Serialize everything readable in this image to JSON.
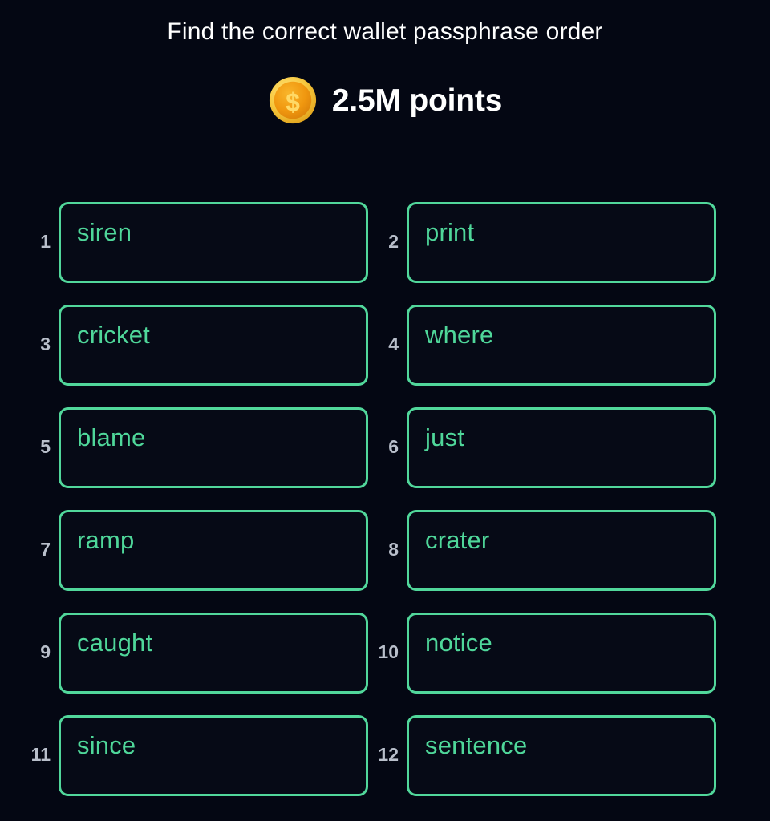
{
  "header": {
    "title": "Find the correct wallet passphrase order",
    "points_label": "2.5M points",
    "coin_icon": "coin-dollar-icon"
  },
  "colors": {
    "background": "#040713",
    "tile_background": "#060a16",
    "tile_border": "#51d79b",
    "word_text": "#4fd79a",
    "index_text": "#b9bfcb",
    "title_text": "#ffffff",
    "coin_outer": "#f5c542",
    "coin_inner": "#f0970f",
    "coin_symbol": "#ffd966"
  },
  "tiles": [
    {
      "index": "1",
      "word": "siren"
    },
    {
      "index": "2",
      "word": "print"
    },
    {
      "index": "3",
      "word": "cricket"
    },
    {
      "index": "4",
      "word": "where"
    },
    {
      "index": "5",
      "word": "blame"
    },
    {
      "index": "6",
      "word": "just"
    },
    {
      "index": "7",
      "ramp_placeholder": "",
      "word": "ramp"
    },
    {
      "index": "8",
      "word": "crater"
    },
    {
      "index": "9",
      "word": "caught"
    },
    {
      "index": "10",
      "word": "notice"
    },
    {
      "index": "11",
      "word": "since"
    },
    {
      "index": "12",
      "word": "sentence"
    }
  ]
}
